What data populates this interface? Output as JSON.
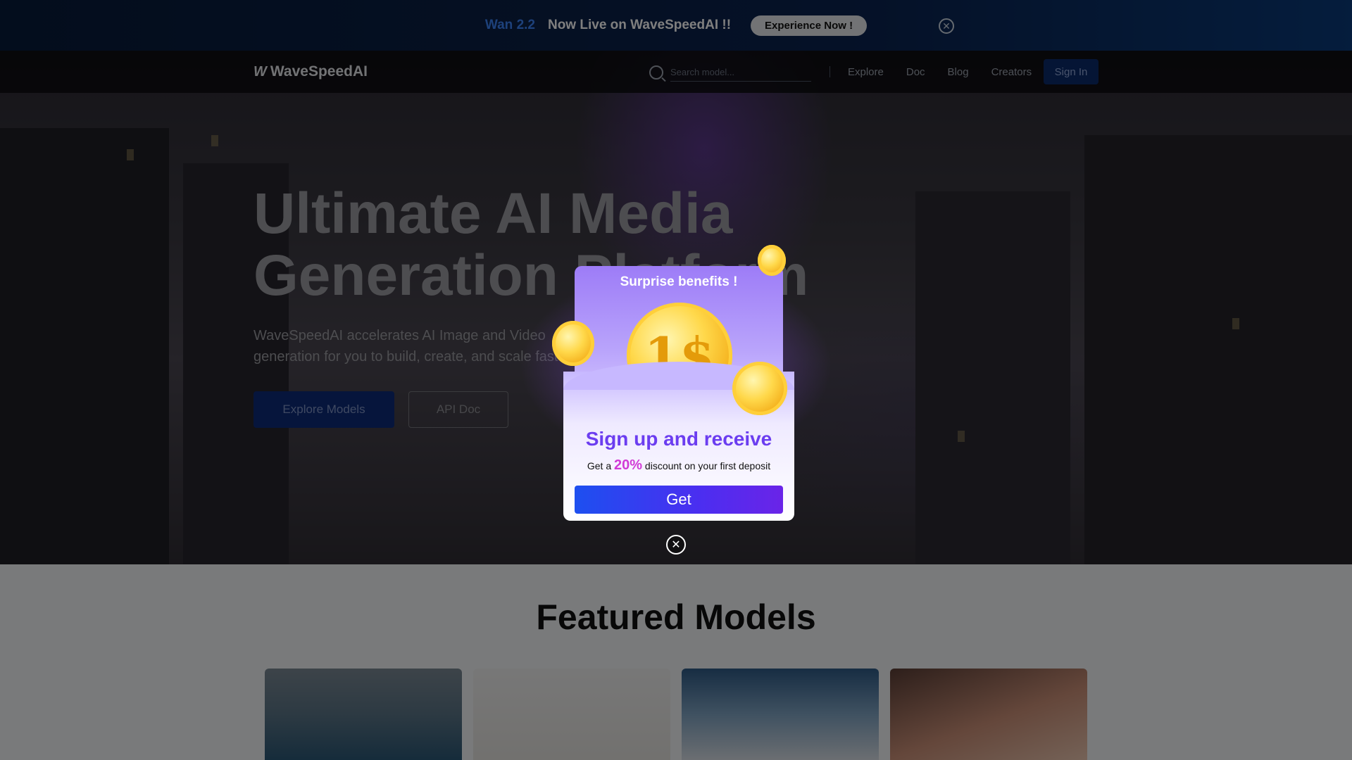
{
  "announcement": {
    "highlight": "Wan 2.2",
    "message": "Now Live on WaveSpeedAI !!",
    "button_label": "Experience Now !",
    "close_icon": "close-circle-icon"
  },
  "nav": {
    "logo_mark": "W",
    "logo_text": "WaveSpeedAI",
    "search_placeholder": "Search model...",
    "links": [
      "Explore",
      "Doc",
      "Blog",
      "Creators"
    ],
    "sign_in_label": "Sign In"
  },
  "hero": {
    "title_line1": "Ultimate AI Media",
    "title_line2": "Generation Platform",
    "subtitle": "WaveSpeedAI accelerates AI Image and Video generation for you to build, create, and scale faster.",
    "primary_cta": "Explore Models",
    "secondary_cta": "API Doc"
  },
  "featured": {
    "title": "Featured Models"
  },
  "popup": {
    "title": "Surprise benefits !",
    "coin_text": "1$",
    "heading": "Sign up and receive",
    "desc_prefix": "Get a",
    "desc_percent": "20%",
    "desc_suffix": "discount on your first deposit",
    "button_label": "Get",
    "close_icon": "close-circle-icon"
  },
  "colors": {
    "accent_blue": "#3b82f6",
    "popup_purple": "#6b3df0",
    "percent_pink": "#d13bd6"
  }
}
